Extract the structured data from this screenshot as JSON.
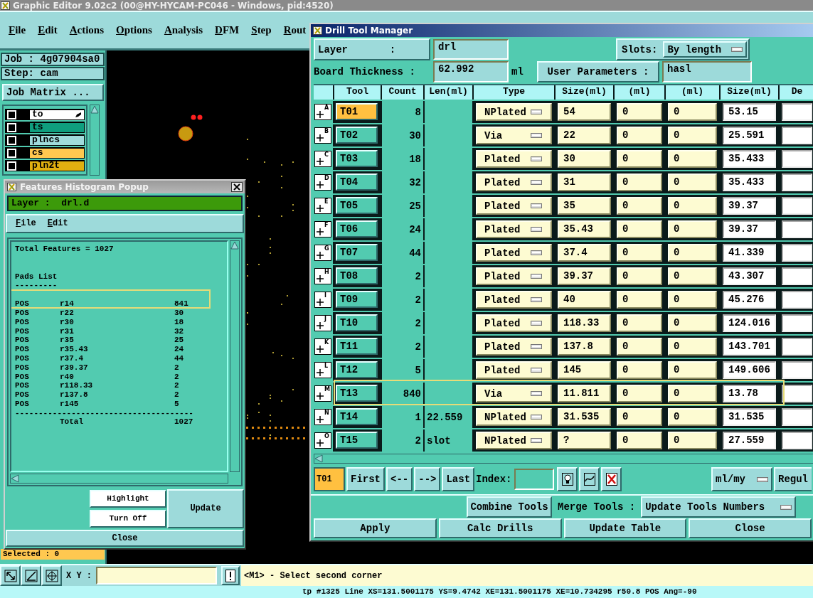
{
  "window": {
    "title": "Graphic Editor 9.02c2 (00@HY-HYCAM-PC046 - Windows, pid:4520)"
  },
  "menu": [
    "File",
    "Edit",
    "Actions",
    "Options",
    "Analysis",
    "DFM",
    "Step",
    "Rout"
  ],
  "job_panel": {
    "job": "Job : 4g07904sa0",
    "step": "Step: cam",
    "matrix_button": "Job Matrix ...",
    "layers": [
      {
        "name": "to",
        "color": "#ffffff",
        "checked": false,
        "selected": true
      },
      {
        "name": "ts",
        "color": "#0f9e7e",
        "checked": false,
        "selected": false
      },
      {
        "name": "plncs",
        "color": "#a0dcdc",
        "checked": false,
        "selected": false
      },
      {
        "name": "cs",
        "color": "#ffc850",
        "checked": false,
        "selected": false
      },
      {
        "name": "pln2t",
        "color": "#e0b010",
        "checked": false,
        "selected": false
      }
    ],
    "selected_info": "Selected : 0"
  },
  "histogram_popup": {
    "title": "Features Histogram Popup",
    "layer": "Layer :  drl.d",
    "menu": [
      "File",
      "Edit"
    ],
    "total_line": "Total Features = 1027",
    "section": "Pads List",
    "underline": "---------",
    "pads": [
      {
        "polarity": "POS",
        "symbol": "r14",
        "count": "841",
        "highlighted": true
      },
      {
        "polarity": "POS",
        "symbol": "r22",
        "count": "30",
        "highlighted": false
      },
      {
        "polarity": "POS",
        "symbol": "r30",
        "count": "18",
        "highlighted": false
      },
      {
        "polarity": "POS",
        "symbol": "r31",
        "count": "32",
        "highlighted": false
      },
      {
        "polarity": "POS",
        "symbol": "r35",
        "count": "25",
        "highlighted": false
      },
      {
        "polarity": "POS",
        "symbol": "r35.43",
        "count": "24",
        "highlighted": false
      },
      {
        "polarity": "POS",
        "symbol": "r37.4",
        "count": "44",
        "highlighted": false
      },
      {
        "polarity": "POS",
        "symbol": "r39.37",
        "count": "2",
        "highlighted": false
      },
      {
        "polarity": "POS",
        "symbol": "r40",
        "count": "2",
        "highlighted": false
      },
      {
        "polarity": "POS",
        "symbol": "r118.33",
        "count": "2",
        "highlighted": false
      },
      {
        "polarity": "POS",
        "symbol": "r137.8",
        "count": "2",
        "highlighted": false
      },
      {
        "polarity": "POS",
        "symbol": "r145",
        "count": "5",
        "highlighted": false
      }
    ],
    "rule": "--------------------------------------",
    "total_label": "Total",
    "total": "1027",
    "buttons": {
      "highlight": "Highlight",
      "turn_off": "Turn Off",
      "update": "Update",
      "close": "Close"
    }
  },
  "drill_tool_manager": {
    "title": "Drill Tool Manager",
    "layer_label": "Layer       :",
    "layer": "drl",
    "slots_label": "Slots:",
    "slots": "By length",
    "thickness_label": "Board Thickness :",
    "thickness": "62.992",
    "thickness_unit": "ml",
    "user_params_button": "User Parameters :",
    "user_params": "hasl",
    "columns": [
      "Tool",
      "Count",
      "Len(ml)",
      "Type",
      "Size(ml)",
      "(ml)",
      "(ml)",
      "Size(ml)",
      "De"
    ],
    "tools": [
      {
        "letter": "A",
        "tool": "T01",
        "selected": true,
        "count": "8",
        "type": "NPlated",
        "size": "54",
        "tol_plus": "0",
        "tol_minus": "0",
        "finish": "53.15",
        "highlighted": false
      },
      {
        "letter": "B",
        "tool": "T02",
        "selected": false,
        "count": "30",
        "type": "Via",
        "size": "22",
        "tol_plus": "0",
        "tol_minus": "0",
        "finish": "25.591",
        "highlighted": false
      },
      {
        "letter": "C",
        "tool": "T03",
        "selected": false,
        "count": "18",
        "type": "Plated",
        "size": "30",
        "tol_plus": "0",
        "tol_minus": "0",
        "finish": "35.433",
        "highlighted": false
      },
      {
        "letter": "D",
        "tool": "T04",
        "selected": false,
        "count": "32",
        "type": "Plated",
        "size": "31",
        "tol_plus": "0",
        "tol_minus": "0",
        "finish": "35.433",
        "highlighted": false
      },
      {
        "letter": "E",
        "tool": "T05",
        "selected": false,
        "count": "25",
        "type": "Plated",
        "size": "35",
        "tol_plus": "0",
        "tol_minus": "0",
        "finish": "39.37",
        "highlighted": false
      },
      {
        "letter": "F",
        "tool": "T06",
        "selected": false,
        "count": "24",
        "type": "Plated",
        "size": "35.43",
        "tol_plus": "0",
        "tol_minus": "0",
        "finish": "39.37",
        "highlighted": false
      },
      {
        "letter": "G",
        "tool": "T07",
        "selected": false,
        "count": "44",
        "type": "Plated",
        "size": "37.4",
        "tol_plus": "0",
        "tol_minus": "0",
        "finish": "41.339",
        "highlighted": false
      },
      {
        "letter": "H",
        "tool": "T08",
        "selected": false,
        "count": "2",
        "type": "Plated",
        "size": "39.37",
        "tol_plus": "0",
        "tol_minus": "0",
        "finish": "43.307",
        "highlighted": false
      },
      {
        "letter": "I",
        "tool": "T09",
        "selected": false,
        "count": "2",
        "type": "Plated",
        "size": "40",
        "tol_plus": "0",
        "tol_minus": "0",
        "finish": "45.276",
        "highlighted": false
      },
      {
        "letter": "J",
        "tool": "T10",
        "selected": false,
        "count": "2",
        "type": "Plated",
        "size": "118.33",
        "tol_plus": "0",
        "tol_minus": "0",
        "finish": "124.016",
        "highlighted": false
      },
      {
        "letter": "K",
        "tool": "T11",
        "selected": false,
        "count": "2",
        "type": "Plated",
        "size": "137.8",
        "tol_plus": "0",
        "tol_minus": "0",
        "finish": "143.701",
        "highlighted": false
      },
      {
        "letter": "L",
        "tool": "T12",
        "selected": false,
        "count": "5",
        "type": "Plated",
        "size": "145",
        "tol_plus": "0",
        "tol_minus": "0",
        "finish": "149.606",
        "highlighted": false
      },
      {
        "letter": "M",
        "tool": "T13",
        "selected": false,
        "count": "840",
        "type": "Via",
        "size": "11.811",
        "tol_plus": "0",
        "tol_minus": "0",
        "finish": "13.78",
        "highlighted": true
      },
      {
        "letter": "N",
        "tool": "T14",
        "selected": false,
        "count": "1",
        "length": "22.559",
        "type": "NPlated",
        "size": "31.535",
        "tol_plus": "0",
        "tol_minus": "0",
        "finish": "31.535",
        "highlighted": false
      },
      {
        "letter": "O",
        "tool": "T15",
        "selected": false,
        "count": "2",
        "length": "slot",
        "type": "NPlated",
        "size": "?",
        "tol_plus": "0",
        "tol_minus": "0",
        "finish": "27.559",
        "highlighted": false
      }
    ],
    "toolbar": {
      "current": "T01",
      "nav": [
        "First",
        "<--",
        "-->",
        "Last"
      ],
      "index_label": "Index:",
      "units": "ml/my",
      "cut_button": "Regul"
    },
    "actions": {
      "combine": "Combine Tools",
      "merge_label": "Merge Tools :",
      "merge_mode": "Update Tools Numbers",
      "buttons": [
        "Apply",
        "Calc Drills",
        "Update Table",
        "Close"
      ]
    }
  },
  "bottom_bar": {
    "xy_label": "X Y :",
    "message": "<M1> - Select second corner",
    "status": "tp #1325 Line XS=131.5001175 YS=9.4742 XE=131.5001175 XE=10.734295 r50.8 POS Ang=-90"
  }
}
